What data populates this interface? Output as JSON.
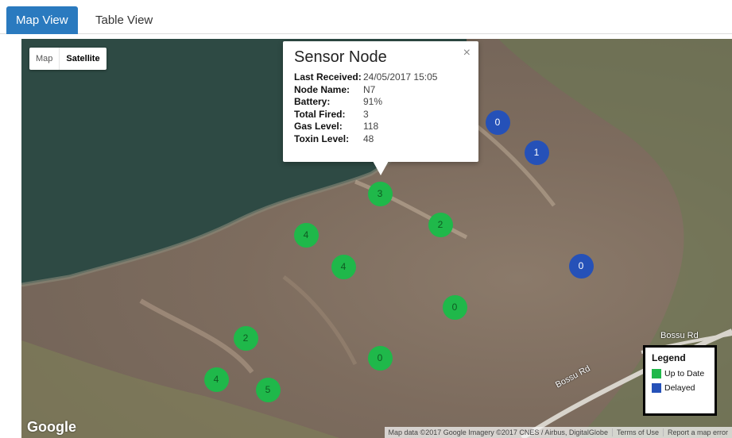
{
  "tabs": {
    "active": "Map View",
    "inactive": "Table View"
  },
  "map_type": {
    "map": "Map",
    "satellite": "Satellite"
  },
  "popup": {
    "title": "Sensor Node",
    "close": "×",
    "fields": [
      {
        "key": "Last Received:",
        "value": "24/05/2017 15:05"
      },
      {
        "key": "Node Name:",
        "value": "N7"
      },
      {
        "key": "Battery:",
        "value": "91%"
      },
      {
        "key": "Total Fired:",
        "value": "3"
      },
      {
        "key": "Gas Level:",
        "value": "118"
      },
      {
        "key": "Toxin Level:",
        "value": "48"
      }
    ]
  },
  "markers": {
    "green_color": "#1fb84a",
    "blue_color": "#2551b8",
    "labels": [
      "0",
      "1",
      "3",
      "2",
      "4",
      "4",
      "0",
      "2",
      "0",
      "4",
      "5",
      "0"
    ]
  },
  "legend": {
    "title": "Legend",
    "items": [
      {
        "label": "Up to Date",
        "color": "#1fb84a"
      },
      {
        "label": "Delayed",
        "color": "#2551b8"
      }
    ]
  },
  "roads": {
    "road1": "Bossu Rd",
    "road2": "Bossu Rd"
  },
  "google_logo": "Google",
  "attribution": {
    "data": "Map data ©2017 Google Imagery ©2017 CNES / Airbus, DigitalGlobe",
    "terms": "Terms of Use",
    "report": "Report a map error"
  }
}
